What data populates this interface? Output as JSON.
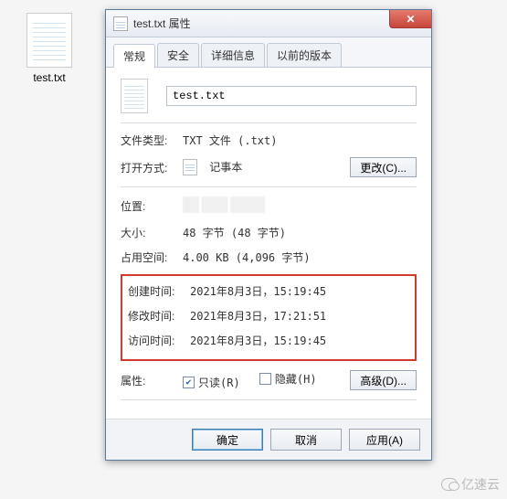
{
  "desktop": {
    "file_name": "test.txt"
  },
  "dialog": {
    "title": "test.txt 属性",
    "close_glyph": "✕",
    "tabs": [
      "常规",
      "安全",
      "详细信息",
      "以前的版本"
    ],
    "filename_value": "test.txt",
    "labels": {
      "file_type": "文件类型:",
      "open_with": "打开方式:",
      "location": "位置:",
      "size": "大小:",
      "disk": "占用空间:",
      "created": "创建时间:",
      "modified": "修改时间:",
      "accessed": "访问时间:",
      "attrs": "属性:"
    },
    "values": {
      "file_type": "TXT 文件 (.txt)",
      "open_with": "记事本",
      "size": "48 字节 (48 字节)",
      "disk": "4.00 KB (4,096 字节)",
      "created": "2021年8月3日，15:19:45",
      "modified": "2021年8月3日，17:21:51",
      "accessed": "2021年8月3日，15:19:45"
    },
    "buttons": {
      "change": "更改(C)...",
      "advanced": "高级(D)...",
      "ok": "确定",
      "cancel": "取消",
      "apply": "应用(A)"
    },
    "checkboxes": {
      "readonly_label": "只读(R)",
      "readonly_checked": true,
      "hidden_label": "隐藏(H)",
      "hidden_checked": false
    }
  },
  "watermark": "亿速云"
}
